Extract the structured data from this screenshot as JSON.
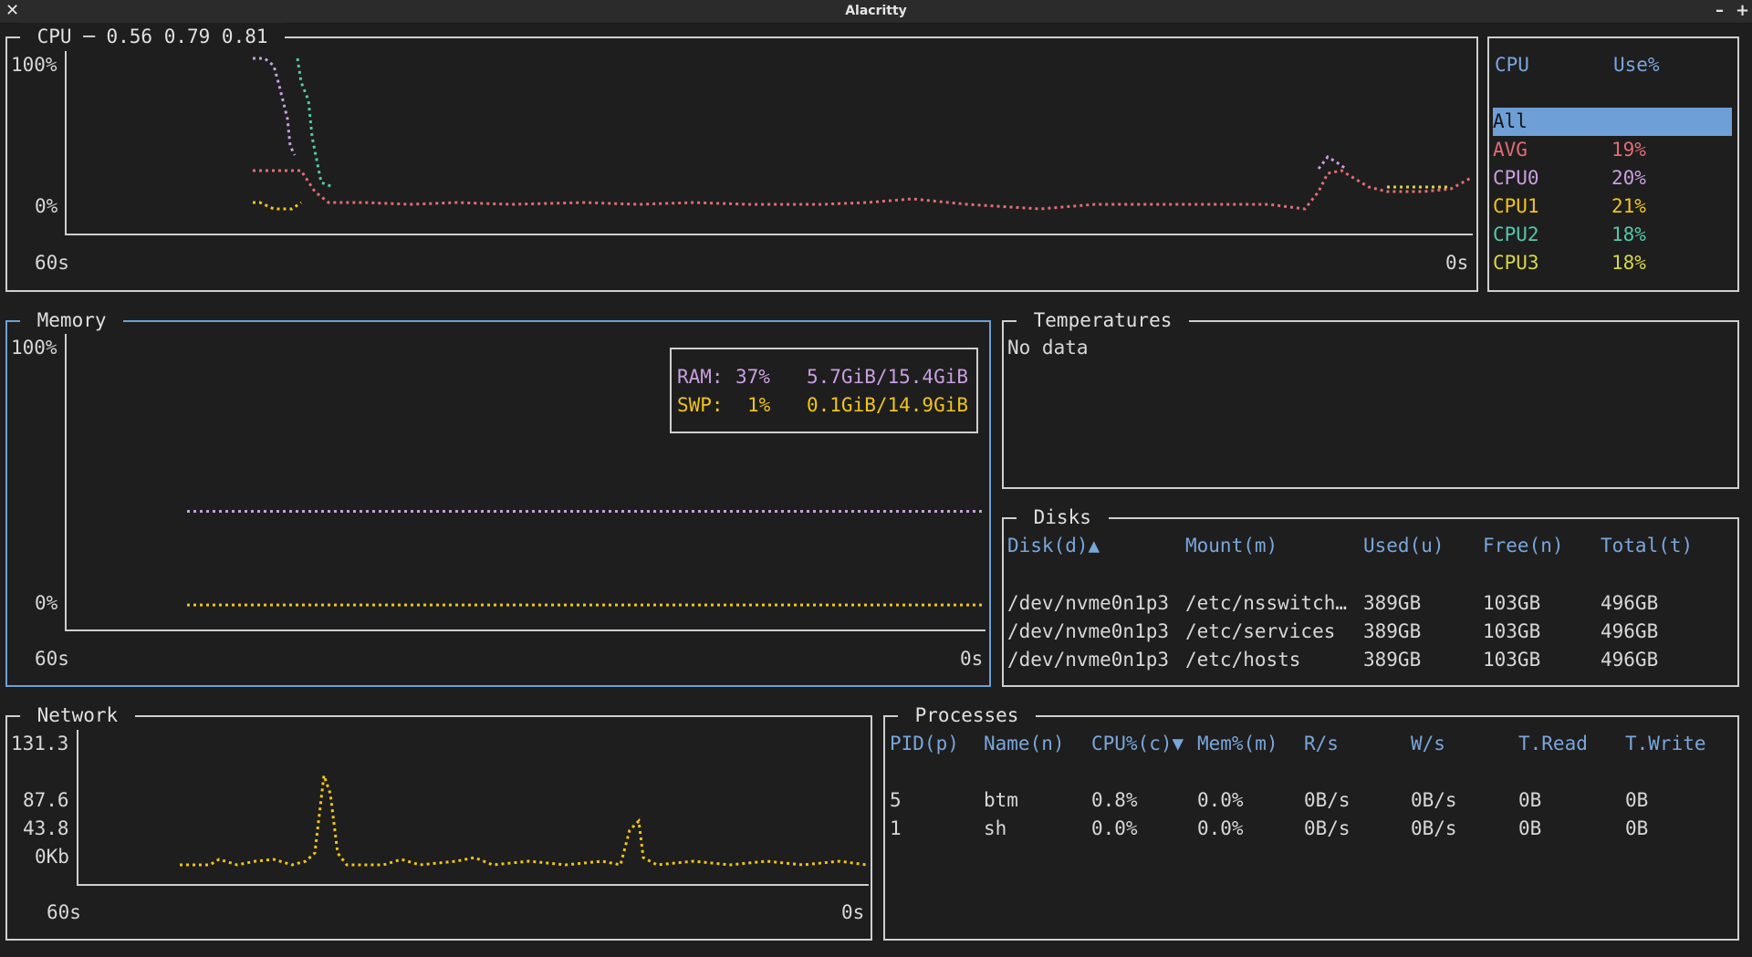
{
  "window": {
    "title": "Alacritty",
    "close_glyph": "✕",
    "min_glyph": "–",
    "max_glyph": "+"
  },
  "colors": {
    "avg": "#e06c75",
    "cpu0": "#c89fe0",
    "cpu1": "#f0c419",
    "cpu2": "#56c7a9",
    "cpu3": "#d6d64a",
    "ram": "#c89fe0",
    "swap": "#f0c419",
    "header": "#7aa6da",
    "border": "#cfcfcf",
    "border_active": "#6e9fd6"
  },
  "cpu_panel": {
    "title": " CPU ─ 0.56 0.79 0.81 ",
    "y_top": "100%",
    "y_bottom": "0%",
    "x_left": "60s",
    "x_right": "0s"
  },
  "cpu_table": {
    "header_cpu": "CPU",
    "header_use": "Use%",
    "rows": [
      {
        "name": "All",
        "use": ""
      },
      {
        "name": "AVG",
        "use": "19%"
      },
      {
        "name": "CPU0",
        "use": "20%"
      },
      {
        "name": "CPU1",
        "use": "21%"
      },
      {
        "name": "CPU2",
        "use": "18%"
      },
      {
        "name": "CPU3",
        "use": "18%"
      }
    ]
  },
  "memory": {
    "title": " Memory ",
    "y_top": "100%",
    "y_bottom": "0%",
    "x_left": "60s",
    "x_right": "0s",
    "ram_label": "RAM:",
    "ram_pct": "37%",
    "ram_val": "5.7GiB/15.4GiB",
    "swp_label": "SWP:",
    "swp_pct": "1%",
    "swp_val": "0.1GiB/14.9GiB",
    "ram_level": 0.37,
    "swap_level": 0.01
  },
  "temperatures": {
    "title": " Temperatures ",
    "empty": "No data"
  },
  "disks": {
    "title": " Disks ",
    "headers": [
      "Disk(d)▲",
      "Mount(m)",
      "Used(u)",
      "Free(n)",
      "Total(t)"
    ],
    "rows": [
      [
        "/dev/nvme0n1p3",
        "/etc/nsswitch…",
        "389GB",
        "103GB",
        "496GB"
      ],
      [
        "/dev/nvme0n1p3",
        "/etc/services",
        "389GB",
        "103GB",
        "496GB"
      ],
      [
        "/dev/nvme0n1p3",
        "/etc/hosts",
        "389GB",
        "103GB",
        "496GB"
      ]
    ]
  },
  "network": {
    "title": " Network ",
    "y_labels": [
      "131.3",
      "87.6",
      "43.8",
      "0Kb"
    ],
    "x_left": "60s",
    "x_right": "0s"
  },
  "processes": {
    "title": " Processes ",
    "headers": [
      "PID(p)",
      "Name(n)",
      "CPU%(c)▼",
      "Mem%(m)",
      "R/s",
      "W/s",
      "T.Read",
      "T.Write"
    ],
    "rows": [
      [
        "5",
        "btm",
        "0.8%",
        "0.0%",
        "0B/s",
        "0B/s",
        "0B",
        "0B"
      ],
      [
        "1",
        "sh",
        "0.0%",
        "0.0%",
        "0B/s",
        "0B/s",
        "0B",
        "0B"
      ]
    ]
  }
}
